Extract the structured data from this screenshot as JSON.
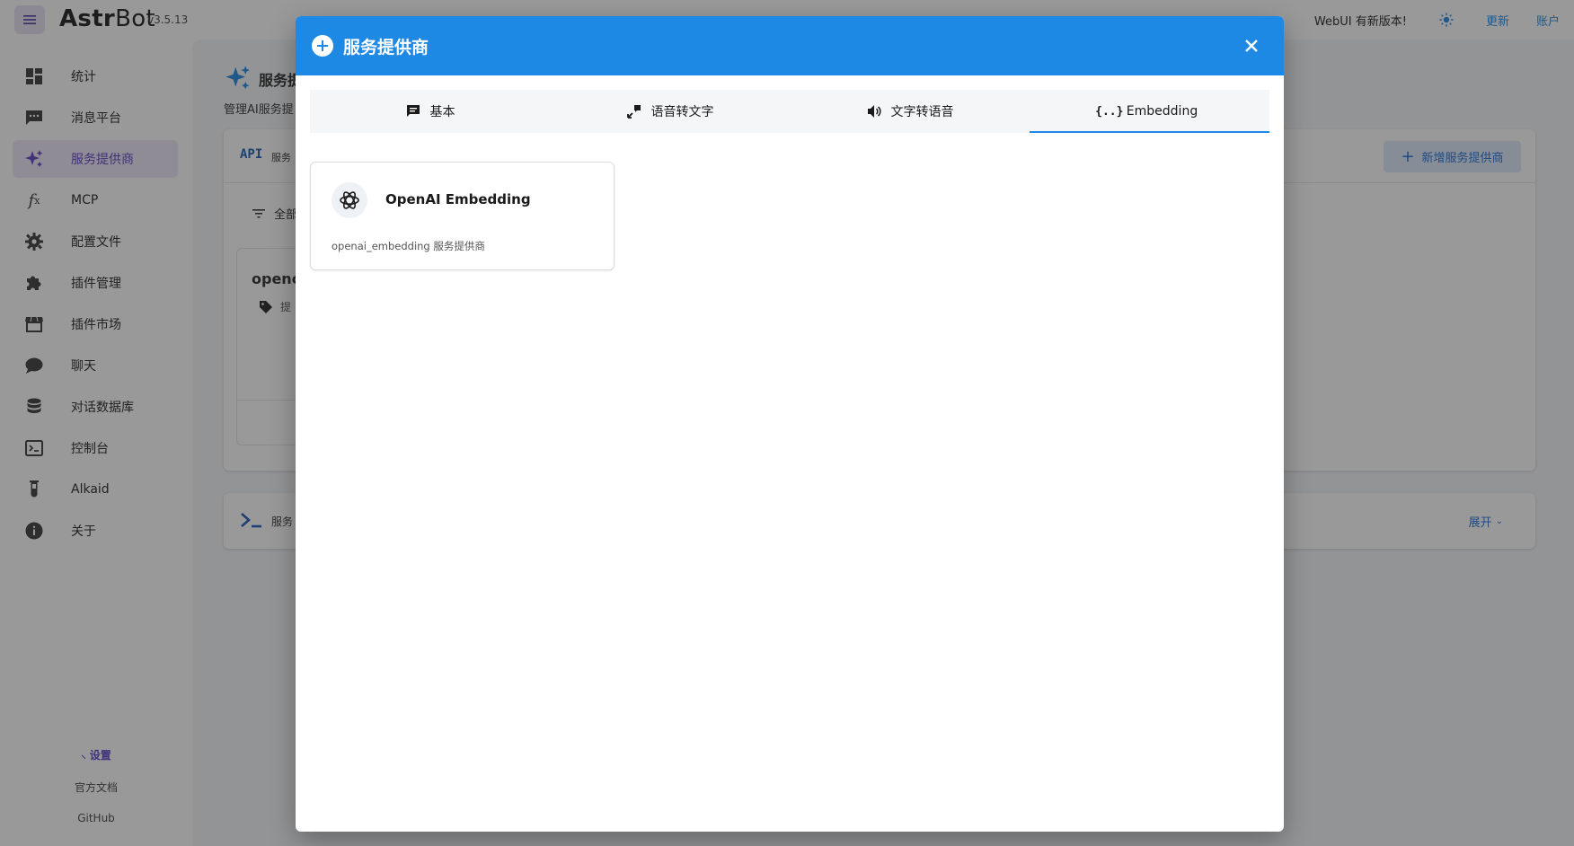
{
  "app": {
    "name_bold": "Astr",
    "name_light": "Bot",
    "version": "v3.5.13"
  },
  "topbar": {
    "update_message": "WebUI 有新版本!",
    "update_link": "更新",
    "account_link": "账户"
  },
  "sidebar": {
    "items": [
      {
        "label": "统计",
        "icon": "dashboard-icon"
      },
      {
        "label": "消息平台",
        "icon": "chat-box-icon"
      },
      {
        "label": "服务提供商",
        "icon": "sparkles-icon",
        "active": true
      },
      {
        "label": "MCP",
        "icon": "function-icon"
      },
      {
        "label": "配置文件",
        "icon": "gear-icon"
      },
      {
        "label": "插件管理",
        "icon": "puzzle-icon"
      },
      {
        "label": "插件市场",
        "icon": "store-icon"
      },
      {
        "label": "聊天",
        "icon": "chat-bubble-icon"
      },
      {
        "label": "对话数据库",
        "icon": "database-icon"
      },
      {
        "label": "控制台",
        "icon": "console-icon"
      },
      {
        "label": "Alkaid",
        "icon": "flask-icon"
      },
      {
        "label": "关于",
        "icon": "info-icon"
      }
    ],
    "footer": {
      "settings": "设置",
      "docs": "官方文档",
      "github": "GitHub"
    }
  },
  "main": {
    "title": "服务提",
    "subtitle": "管理AI服务提",
    "api_badge": "API",
    "api_label": "服务",
    "add_button": "新增服务提供商",
    "filter_label": "全部",
    "inner_card_title": "openc",
    "inner_card_tag": "提",
    "log_label": "服务",
    "expand_link": "展开"
  },
  "dialog": {
    "title": "服务提供商",
    "tabs": [
      {
        "label": "基本",
        "icon": "message-icon"
      },
      {
        "label": "语音转文字",
        "icon": "speech-to-text-icon"
      },
      {
        "label": "文字转语音",
        "icon": "volume-icon"
      },
      {
        "label": "Embedding",
        "icon": "code-braces-icon",
        "active": true
      }
    ],
    "providers": [
      {
        "name": "OpenAI Embedding",
        "description": "openai_embedding 服务提供商",
        "icon": "openai-logo-icon"
      }
    ]
  },
  "colors": {
    "accent": "#1e88e5",
    "sidebar_active": "#5b3fc4",
    "overlay": "rgba(33,33,33,0.46)"
  }
}
